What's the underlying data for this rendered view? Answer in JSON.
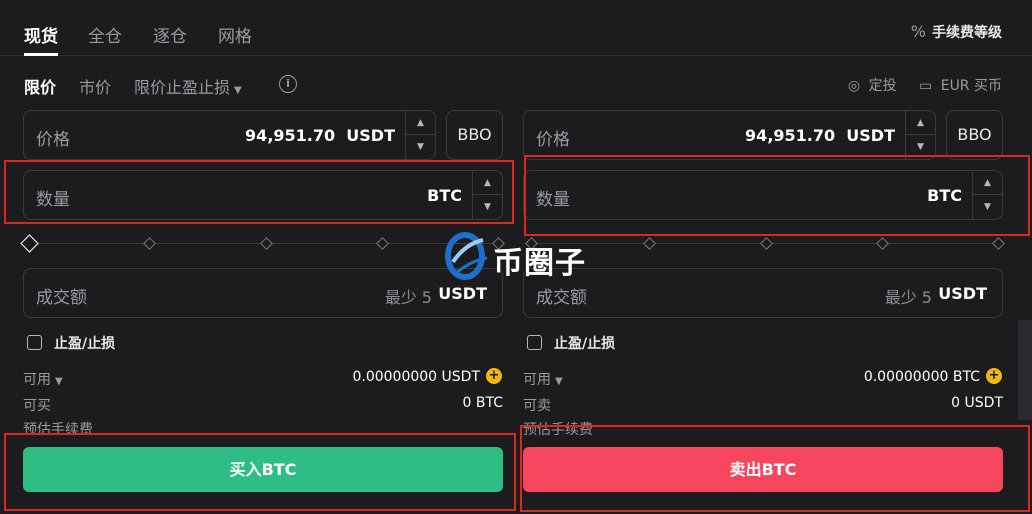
{
  "top_tabs": [
    "现货",
    "全仓",
    "逐仓",
    "网格"
  ],
  "fee_link": "手续费等级",
  "fee_icon": "%",
  "order_types": {
    "limit": "限价",
    "market": "市价",
    "tpsl": "限价止盈止损"
  },
  "info_icon": "i",
  "right_links": {
    "dca": "定投",
    "eur": "EUR 买币"
  },
  "left": {
    "price_label": "价格",
    "price_value": "94,951.70",
    "price_unit": "USDT",
    "bbo": "BBO",
    "qty_label": "数量",
    "qty_unit": "BTC",
    "amount_label": "成交额",
    "amount_hint": "最少 5",
    "amount_unit": "USDT",
    "tpsl_label": "止盈/止损",
    "available_label": "可用",
    "available_value": "0.00000000 USDT",
    "can_label": "可买",
    "can_value": "0 BTC",
    "fee_label": "预估手续费",
    "action": "买入BTC"
  },
  "right": {
    "price_label": "价格",
    "price_value": "94,951.70",
    "price_unit": "USDT",
    "bbo": "BBO",
    "qty_label": "数量",
    "qty_unit": "BTC",
    "amount_label": "成交额",
    "amount_hint": "最少 5",
    "amount_unit": "USDT",
    "tpsl_label": "止盈/止损",
    "available_label": "可用",
    "available_value": "0.00000000 BTC",
    "can_label": "可卖",
    "can_value": "0 USDT",
    "fee_label": "预估手续费",
    "action": "卖出BTC"
  },
  "stepper": {
    "up": "▲",
    "down": "▼"
  },
  "coin_icon": "+",
  "watermark": "币圈子",
  "colors": {
    "buy": "#2ebd85",
    "sell": "#f6465d",
    "highlight": "#d8281f",
    "coin": "#f0b90b"
  }
}
